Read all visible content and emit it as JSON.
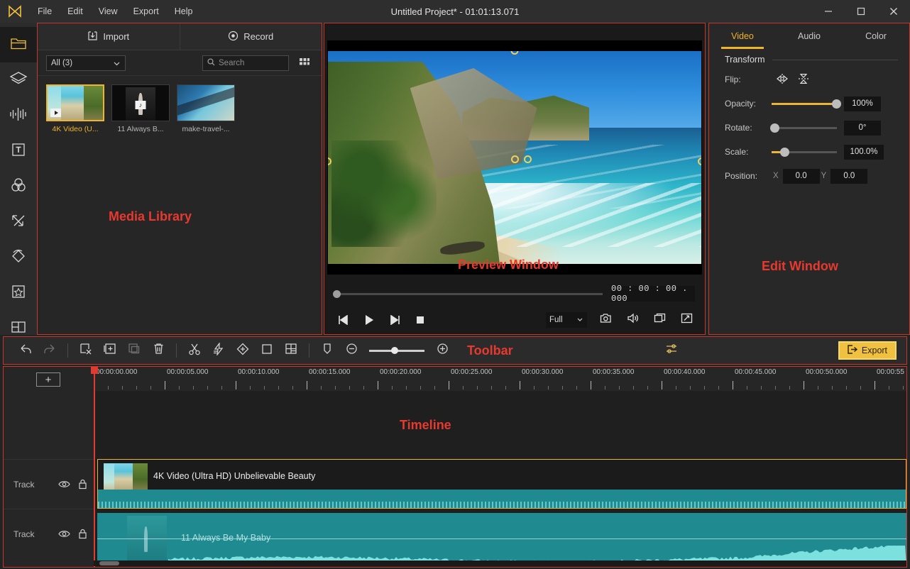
{
  "window": {
    "title": "Untitled Project* - 01:01:13.071",
    "logo_icon": "play-triangle-logo",
    "controls": [
      {
        "name": "minimize-button",
        "icon": "minimize-icon"
      },
      {
        "name": "maximize-button",
        "icon": "maximize-icon"
      },
      {
        "name": "close-button",
        "icon": "close-icon"
      }
    ]
  },
  "menubar": {
    "items": [
      {
        "label": "File"
      },
      {
        "label": "Edit"
      },
      {
        "label": "View"
      },
      {
        "label": "Export"
      },
      {
        "label": "Help"
      }
    ]
  },
  "rail": {
    "items": [
      {
        "name": "sidebar-item-media",
        "icon": "folder-icon",
        "active": true
      },
      {
        "name": "sidebar-item-effects",
        "icon": "layers-icon",
        "active": false
      },
      {
        "name": "sidebar-item-audio",
        "icon": "waveform-icon",
        "active": false
      },
      {
        "name": "sidebar-item-titles",
        "icon": "text-t-icon",
        "active": false
      },
      {
        "name": "sidebar-item-filters",
        "icon": "color-circles-icon",
        "active": false
      },
      {
        "name": "sidebar-item-transitions",
        "icon": "transition-arrows-icon",
        "active": false
      },
      {
        "name": "sidebar-item-elements",
        "icon": "diamond-swirl-icon",
        "active": false
      },
      {
        "name": "sidebar-item-favorites",
        "icon": "star-box-icon",
        "active": false
      },
      {
        "name": "sidebar-item-splitscreen",
        "icon": "split-layout-icon",
        "active": false
      }
    ]
  },
  "media": {
    "annotation": "Media Library",
    "tabs": [
      {
        "label": "Import",
        "icon": "import-icon"
      },
      {
        "label": "Record",
        "icon": "record-icon"
      }
    ],
    "filter_value": "All (3)",
    "search_placeholder": "Search",
    "search_icon": "search-icon",
    "grid_view_icon": "grid-view-icon",
    "items": [
      {
        "name": "media-item-video",
        "caption": "4K Video (U...",
        "badge": "play-badge",
        "selected": true,
        "art": "beach"
      },
      {
        "name": "media-item-music",
        "caption": "11 Always B...",
        "badge": "music-badge",
        "selected": false,
        "art": "music"
      },
      {
        "name": "media-item-travel",
        "caption": "make-travel-...",
        "badge": "none",
        "selected": false,
        "art": "travel"
      }
    ]
  },
  "preview": {
    "annotation": "Preview Window",
    "timecode": "00 : 00 : 00 . 000",
    "quality_value": "Full",
    "transport": [
      {
        "name": "prev-frame-button",
        "icon": "previous-frame-icon"
      },
      {
        "name": "play-button",
        "icon": "play-icon"
      },
      {
        "name": "next-frame-button",
        "icon": "next-frame-icon"
      },
      {
        "name": "stop-button",
        "icon": "stop-icon"
      }
    ],
    "right_tools": [
      {
        "name": "snapshot-button",
        "icon": "camera-icon"
      },
      {
        "name": "volume-button",
        "icon": "speaker-icon"
      },
      {
        "name": "pip-button",
        "icon": "pip-screen-icon"
      },
      {
        "name": "fullscreen-button",
        "icon": "fullscreen-arrows-icon"
      }
    ]
  },
  "edit": {
    "annotation": "Edit Window",
    "tabs": [
      {
        "label": "Video",
        "active": true
      },
      {
        "label": "Audio",
        "active": false
      },
      {
        "label": "Color",
        "active": false
      }
    ],
    "section_title": "Transform",
    "flip_label": "Flip:",
    "flip_horizontal_icon": "flip-horizontal-icon",
    "flip_vertical_icon": "flip-vertical-icon",
    "opacity_label": "Opacity:",
    "opacity_value": "100%",
    "opacity_percent": 100,
    "rotate_label": "Rotate:",
    "rotate_value": "0°",
    "rotate_percent": 0,
    "scale_label": "Scale:",
    "scale_value": "100.0%",
    "scale_percent": 20,
    "position_label": "Position:",
    "position_x_label": "X",
    "position_x_value": "0.0",
    "position_y_label": "Y",
    "position_y_value": "0.0"
  },
  "toolbar": {
    "annotation": "Toolbar",
    "buttons": [
      {
        "name": "undo-button",
        "icon": "undo-arrow-icon",
        "dim": false
      },
      {
        "name": "redo-button",
        "icon": "redo-arrow-icon",
        "dim": true
      },
      {
        "name": "cut-clip-button",
        "icon": "scissors-box-icon",
        "dim": false
      },
      {
        "name": "add-clip-button",
        "icon": "plus-box-icon",
        "dim": false
      },
      {
        "name": "copy-clip-button",
        "icon": "copy-icon",
        "dim": true
      },
      {
        "name": "delete-clip-button",
        "icon": "trash-icon",
        "dim": false
      },
      {
        "name": "split-button",
        "icon": "scissors-icon",
        "dim": false
      },
      {
        "name": "speed-button",
        "icon": "lightning-icon",
        "dim": false
      },
      {
        "name": "keyframe-button",
        "icon": "diamond-plus-icon",
        "dim": false
      },
      {
        "name": "crop-button",
        "icon": "crop-square-icon",
        "dim": false
      },
      {
        "name": "splitscreen-button",
        "icon": "grid-layout-icon",
        "dim": false
      },
      {
        "name": "marker-button",
        "icon": "marker-flag-icon",
        "dim": false
      }
    ],
    "zoom_out_icon": "zoom-out-circle-icon",
    "zoom_in_icon": "zoom-in-circle-icon",
    "zoom_percent": 40,
    "settings_icon": "sliders-icon",
    "export_label": "Export",
    "export_icon": "export-arrow-icon",
    "export_color": "#f0c040"
  },
  "timeline": {
    "annotation": "Timeline",
    "add_track_label": "+",
    "playhead_color": "#e03b30",
    "ruler_ticks": [
      "00:00:00.000",
      "00:00:05.000",
      "00:00:10.000",
      "00:00:15.000",
      "00:00:20.000",
      "00:00:25.000",
      "00:00:30.000",
      "00:00:35.000",
      "00:00:40.000",
      "00:00:45.000",
      "00:00:50.000",
      "00:00:55"
    ],
    "tracks": [
      {
        "name": "track-video",
        "label": "Track",
        "eye_icon": "eye-icon",
        "lock_icon": "lock-icon",
        "clip_label": "4K Video (Ultra HD) Unbelievable Beauty",
        "selected": true
      },
      {
        "name": "track-audio",
        "label": "Track",
        "eye_icon": "eye-icon",
        "lock_icon": "lock-icon",
        "clip_label": "11 Always Be My Baby",
        "selected": false
      }
    ]
  }
}
